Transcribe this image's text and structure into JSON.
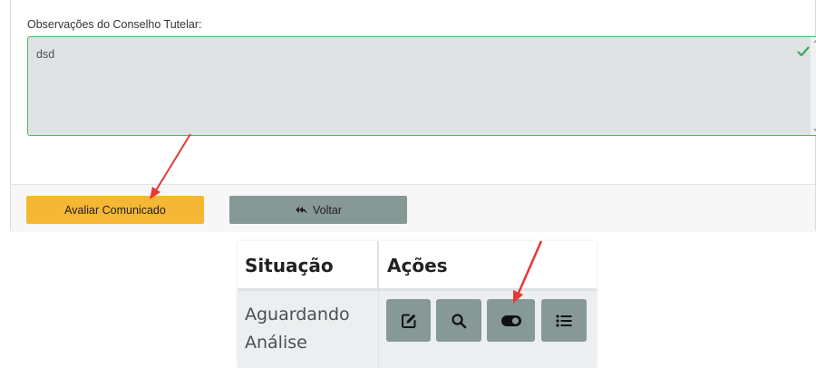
{
  "form": {
    "observations_label": "Observações do Conselho Tutelar:",
    "observations_value": "dsd",
    "evaluate_button": "Avaliar Comunicado",
    "back_button": "Voltar"
  },
  "table": {
    "columns": [
      "Situação",
      "Ações"
    ],
    "row": {
      "status": "Aguardando Análise",
      "actions": [
        "edit-icon",
        "search-icon",
        "toggle-icon",
        "list-icon"
      ]
    }
  },
  "colors": {
    "evaluate_button": "#f6b734",
    "secondary_button": "#869996",
    "valid_border": "#4fb866",
    "annotation_arrow": "#e53935"
  }
}
